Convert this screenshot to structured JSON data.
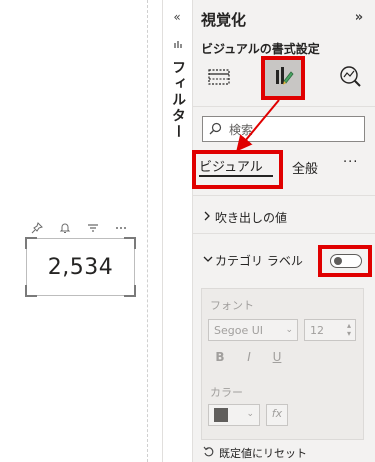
{
  "canvas": {
    "card_value": "2,534",
    "toolbar_icons": [
      "pin-icon",
      "bell-icon",
      "filter-icon",
      "more-icon"
    ]
  },
  "filters_rail": {
    "collapse_glyph": "«",
    "label": "フィルター"
  },
  "visualizations_pane": {
    "title": "視覚化",
    "expand_glyph": "»",
    "subtitle": "ビジュアルの書式設定",
    "tools": [
      "build-visual-icon",
      "format-visual-icon",
      "analytics-icon"
    ],
    "search_placeholder": "検索",
    "tabs": [
      {
        "label": "ビジュアル",
        "active": true
      },
      {
        "label": "全般",
        "active": false
      }
    ],
    "more_label": "···",
    "sections": [
      {
        "label": "吹き出しの値",
        "expanded": false
      },
      {
        "label": "カテゴリ ラベル",
        "expanded": true,
        "toggle_on": false
      }
    ],
    "category_label_panel": {
      "font_label": "フォント",
      "font_family": "Segoe UI",
      "font_size": "12",
      "bold": "B",
      "italic": "I",
      "underline": "U",
      "color_label": "カラー",
      "fx_label": "fx"
    },
    "reset_label": "既定値にリセット"
  },
  "annotation_color": "#e00000"
}
